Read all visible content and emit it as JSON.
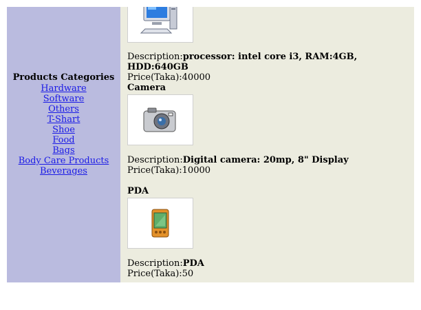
{
  "sidebar": {
    "title": "Products Categories",
    "categories": [
      "Hardware",
      "Software",
      "Others",
      "T-Shart",
      "Shoe",
      "Food",
      "Bags",
      "Body Care Products",
      "Beverages"
    ]
  },
  "products": [
    {
      "name": "",
      "icon": "computer-icon",
      "desc_label": "Description:",
      "desc_value": "processor: intel core i3, RAM:4GB, HDD:640GB",
      "price": "Price(Taka):40000"
    },
    {
      "name": "Camera",
      "icon": "camera-icon",
      "desc_label": "Description:",
      "desc_value": "Digital camera: 20mp, 8\" Display",
      "price": "Price(Taka):10000"
    },
    {
      "name": "PDA",
      "icon": "pda-icon",
      "desc_label": "Description:",
      "desc_value": "PDA",
      "price": "Price(Taka):50"
    }
  ],
  "colors": {
    "sidebar_bg": "#babbdf",
    "main_bg": "#ececdf",
    "link": "#1a1ae6"
  }
}
